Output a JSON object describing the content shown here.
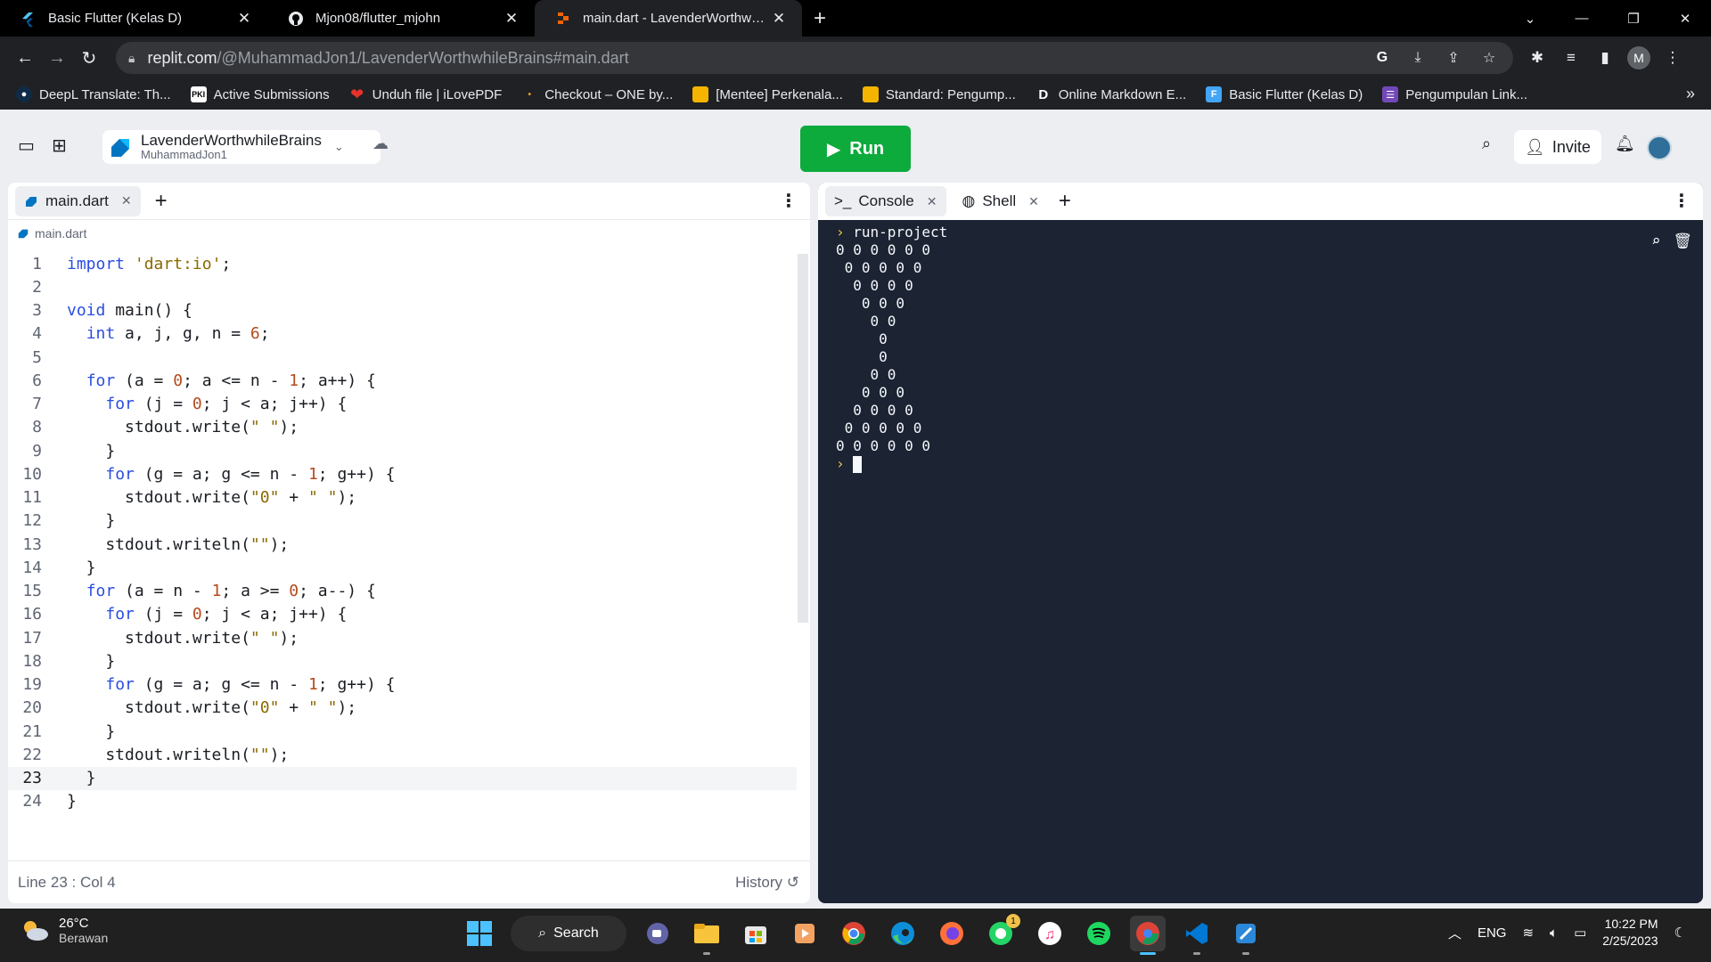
{
  "browser": {
    "tabs": [
      {
        "title": "Basic Flutter (Kelas D)",
        "icon": "flutter-icon",
        "active": false
      },
      {
        "title": "Mjon08/flutter_mjohn",
        "icon": "github-icon",
        "active": false
      },
      {
        "title": "main.dart - LavenderWorthwhileB",
        "icon": "replit-icon",
        "active": true
      }
    ],
    "url_host": "replit.com",
    "url_path": "/@MuhammadJon1/LavenderWorthwhileBrains#main.dart",
    "profile_initial": "M",
    "bookmarks": [
      {
        "label": "DeepL Translate: Th...",
        "icon": "deepl-icon",
        "color": "#1a2a44"
      },
      {
        "label": "Active Submissions",
        "icon": "pki-icon",
        "color": "#ffffff"
      },
      {
        "label": "Unduh file | iLovePDF",
        "icon": "ilovepdf-icon",
        "color": "#e5322d"
      },
      {
        "label": "Checkout – ONE by...",
        "icon": "dot-icon",
        "color": "#f0a020"
      },
      {
        "label": "[Mentee] Perkenala...",
        "icon": "slides-icon",
        "color": "#f4b400"
      },
      {
        "label": "Standard: Pengump...",
        "icon": "slides-icon",
        "color": "#f4b400"
      },
      {
        "label": "Online Markdown E...",
        "icon": "d-icon",
        "color": "#202124"
      },
      {
        "label": "Basic Flutter (Kelas D)",
        "icon": "flutter-icon",
        "color": "#42a5f5"
      },
      {
        "label": "Pengumpulan Link...",
        "icon": "forms-icon",
        "color": "#7248b9"
      }
    ]
  },
  "repl": {
    "name": "LavenderWorthwhileBrains",
    "owner": "MuhammadJon1",
    "run_label": "Run",
    "invite_label": "Invite"
  },
  "editor": {
    "tab_label": "main.dart",
    "breadcrumb": "main.dart",
    "current_line": 23,
    "status": "Line 23 : Col 4",
    "history_label": "History",
    "lines": [
      "import 'dart:io';",
      "",
      "void main() {",
      "  int a, j, g, n = 6;",
      "",
      "  for (a = 0; a <= n - 1; a++) {",
      "    for (j = 0; j < a; j++) {",
      "      stdout.write(\" \");",
      "    }",
      "    for (g = a; g <= n - 1; g++) {",
      "      stdout.write(\"0\" + \" \");",
      "    }",
      "    stdout.writeln(\"\");",
      "  }",
      "  for (a = n - 1; a >= 0; a--) {",
      "    for (j = 0; j < a; j++) {",
      "      stdout.write(\" \");",
      "    }",
      "    for (g = a; g <= n - 1; g++) {",
      "      stdout.write(\"0\" + \" \");",
      "    }",
      "    stdout.writeln(\"\");",
      "  }",
      "}"
    ]
  },
  "console": {
    "tab_console": "Console",
    "tab_shell": "Shell",
    "command": "run-project",
    "output": [
      "0 0 0 0 0 0",
      " 0 0 0 0 0",
      "  0 0 0 0",
      "   0 0 0",
      "    0 0",
      "     0",
      "     0",
      "    0 0",
      "   0 0 0",
      "  0 0 0 0",
      " 0 0 0 0 0",
      "0 0 0 0 0 0"
    ]
  },
  "taskbar": {
    "temperature": "26°C",
    "weather": "Berawan",
    "search_label": "Search",
    "language": "ENG",
    "time": "10:22 PM",
    "date": "2/25/2023",
    "whatsapp_badge": "1"
  }
}
